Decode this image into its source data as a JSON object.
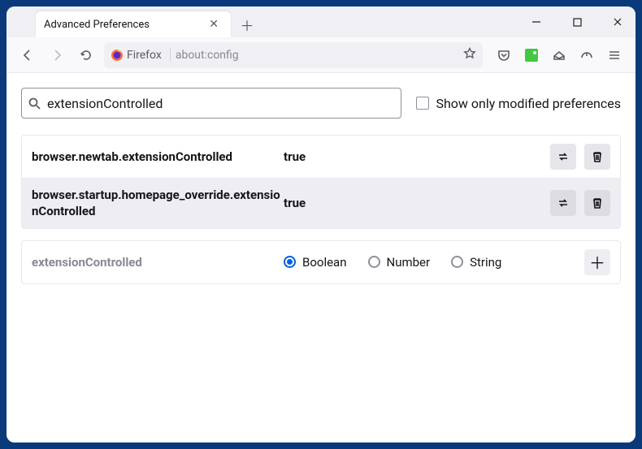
{
  "tab": {
    "title": "Advanced Preferences"
  },
  "urlbar": {
    "identity": "Firefox",
    "path": "about:config"
  },
  "search": {
    "value": "extensionControlled"
  },
  "checkbox": {
    "label": "Show only modified preferences",
    "checked": false
  },
  "prefs": [
    {
      "name": "browser.newtab.extensionControlled",
      "value": "true",
      "active": false
    },
    {
      "name": "browser.startup.homepage_override.extensionControlled",
      "value": "true",
      "active": true
    }
  ],
  "add": {
    "name": "extensionControlled",
    "types": [
      {
        "label": "Boolean",
        "selected": true
      },
      {
        "label": "Number",
        "selected": false
      },
      {
        "label": "String",
        "selected": false
      }
    ]
  }
}
